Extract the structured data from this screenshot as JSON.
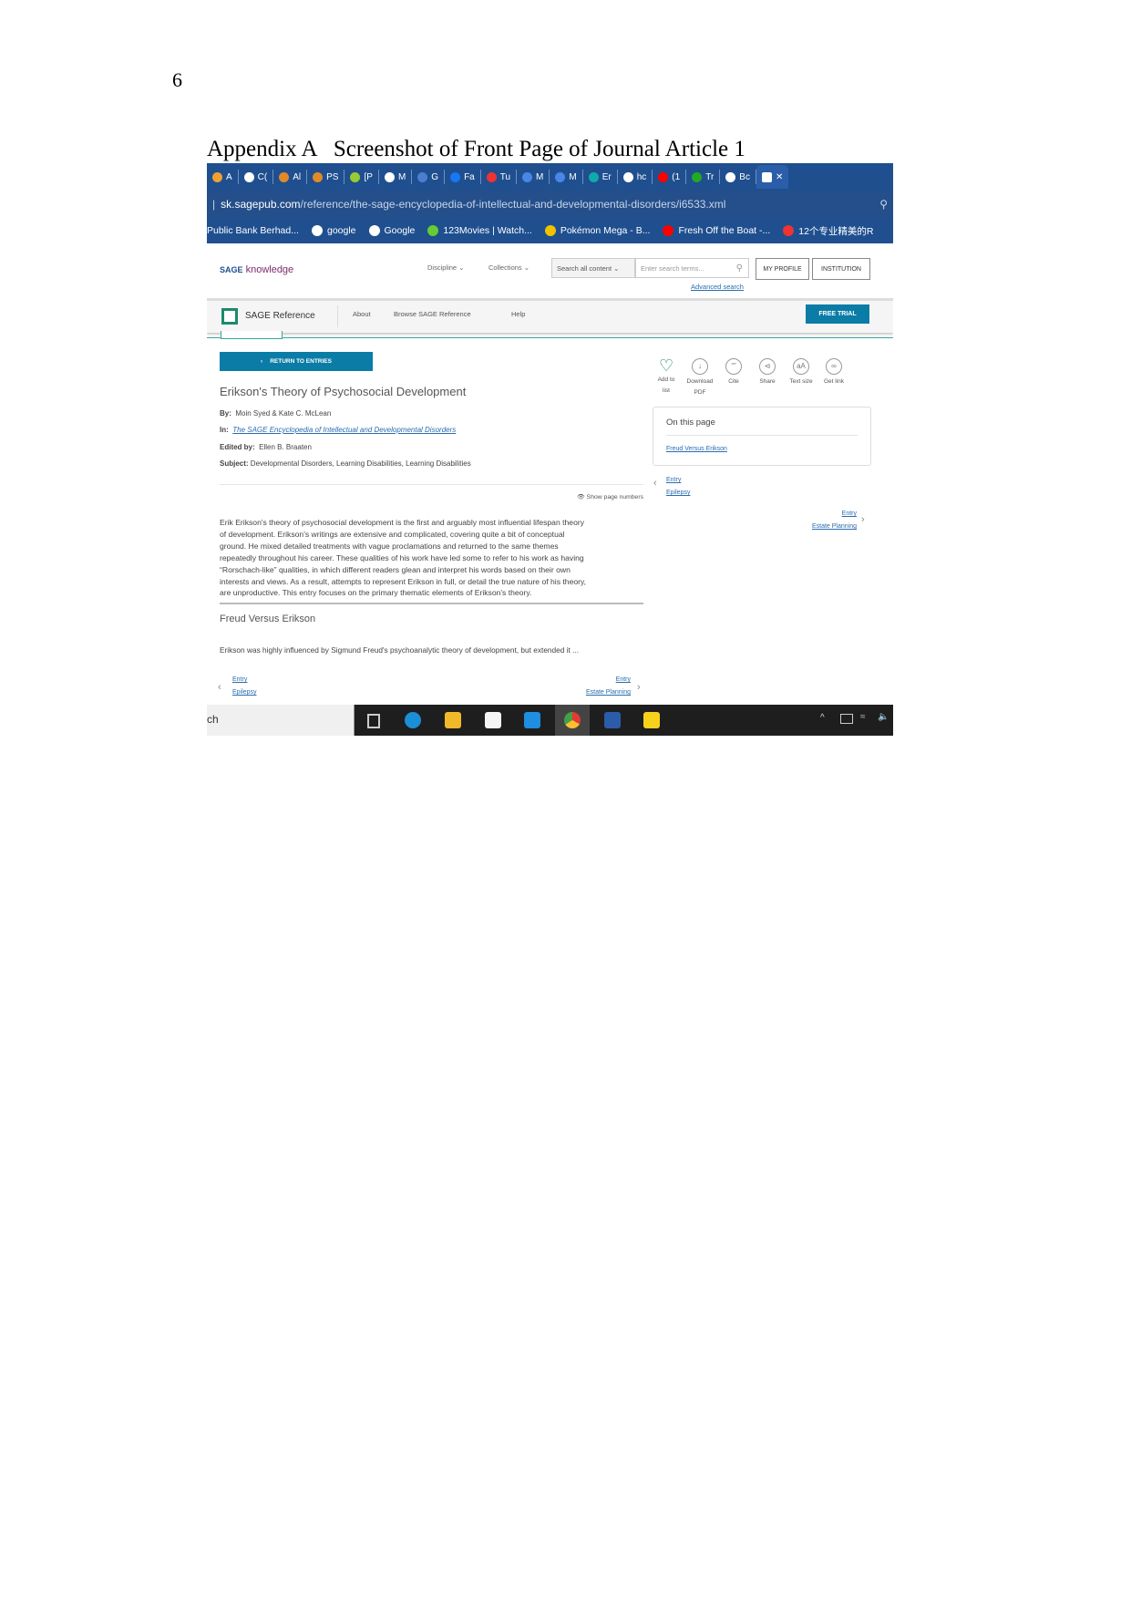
{
  "document": {
    "page_number": "6",
    "caption": "Appendix A   Screenshot of Front Page of Journal Article 1"
  },
  "browser": {
    "tabs": [
      "A",
      "C(",
      "Al",
      "PS",
      "[P",
      "M",
      "G",
      "Fa",
      "Tu",
      "M",
      "M",
      "Er",
      "hc",
      "(1",
      "Tr",
      "Bc"
    ],
    "active_tab_close": "✕",
    "url_host": "sk.sagepub.com",
    "url_path": "/reference/the-sage-encyclopedia-of-intellectual-and-developmental-disorders/i6533.xml",
    "bookmarks": [
      "Public Bank Berhad...",
      "google",
      "Google",
      "123Movies | Watch...",
      "Pokémon Mega - B...",
      "Fresh Off the Boat -...",
      "12个专业精美的R"
    ]
  },
  "site_header": {
    "logo_sage": "SAGE",
    "logo_knowledge": "knowledge",
    "discipline": "Discipline",
    "collections": "Collections",
    "search_scope": "Search all content",
    "search_placeholder": "Enter search terms...",
    "my_profile": "MY PROFILE",
    "institution": "INSTITUTION",
    "advanced_search": "Advanced search"
  },
  "subnav": {
    "brand": "SAGE Reference",
    "about": "About",
    "browse": "Browse SAGE Reference",
    "help": "Help",
    "free_trial": "FREE TRIAL"
  },
  "article": {
    "return_label": "RETURN TO ENTRIES",
    "title": "Erikson's Theory of Psychosocial Development",
    "by_label": "By:",
    "by": "Moin Syed & Kate C. McLean",
    "in_label": "In:",
    "in": "The SAGE Encyclopedia of Intellectual and Developmental Disorders",
    "edited_label": "Edited by:",
    "edited": "Ellen B. Braaten",
    "subject_label": "Subject:",
    "subject": "Developmental Disorders, Learning Disabilities, Learning Disabilities",
    "show_page_numbers": "Show page numbers",
    "paragraph_lines": [
      "Erik Erikson's theory of psychosocial development is the first and arguably most influential lifespan theory",
      "of development. Erikson's writings are extensive and complicated, covering quite a bit of conceptual",
      "ground. He mixed detailed treatments with vague proclamations and returned to the same themes",
      "repeatedly throughout his career. These qualities of his work have led some to refer to his work as having",
      "“Rorschach-like” qualities, in which different readers glean and interpret his words based on their own",
      "interests and views. As a result, attempts to represent Erikson in full, or detail the true nature of his theory,",
      "are unproductive. This entry focuses on the primary thematic elements of Erikson's theory."
    ],
    "section_heading": "Freud Versus Erikson",
    "section_preview": "Erikson was highly influenced by Sigmund Freud's psychoanalytic theory of development, but extended it ...",
    "prev_label": "Entry",
    "prev_title": "Epilepsy",
    "next_label": "Entry",
    "next_title": "Estate Planning"
  },
  "actions": [
    {
      "label1": "Add to",
      "label2": "list",
      "icon": "heart-icon"
    },
    {
      "label1": "Download",
      "label2": "PDF",
      "icon": "download-icon"
    },
    {
      "label1": "Cite",
      "label2": "",
      "icon": "cite-icon"
    },
    {
      "label1": "Share",
      "label2": "",
      "icon": "share-icon"
    },
    {
      "label1": "Text size",
      "label2": "",
      "icon": "text-size-icon"
    },
    {
      "label1": "Get link",
      "label2": "",
      "icon": "link-icon"
    }
  ],
  "on_this_page": {
    "heading": "On this page",
    "link": "Freud Versus Erikson"
  },
  "taskbar": {
    "search_text": "ch"
  },
  "colors": {
    "browser_blue": "#1f4f8f",
    "sage_teal": "#0b7ca6",
    "link_blue": "#2a6cb0",
    "taskbar": "#1e1e1e"
  }
}
